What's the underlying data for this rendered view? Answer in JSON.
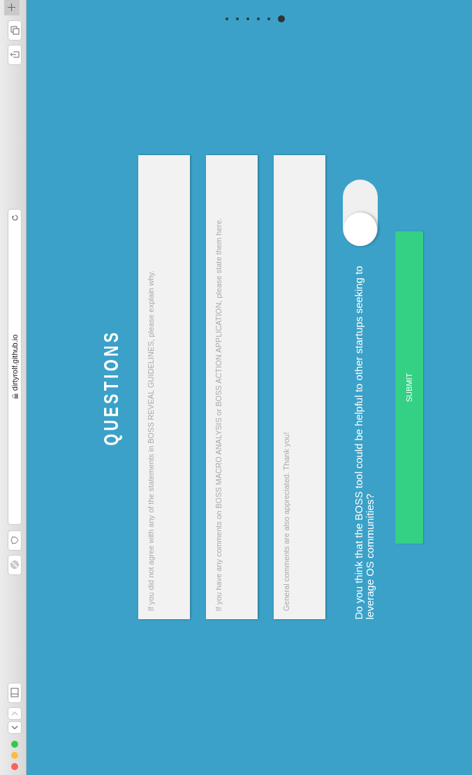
{
  "browser": {
    "address": "dirtyrolf.github.io"
  },
  "page_dots": [
    {
      "selected": false
    },
    {
      "selected": false
    },
    {
      "selected": false
    },
    {
      "selected": false
    },
    {
      "selected": false
    },
    {
      "selected": true
    }
  ],
  "heading": "QUESTIONS",
  "comment_fields": [
    {
      "placeholder": "If you did not agree with any of the statements in BOSS REVEAL GUIDELINES, please explain why."
    },
    {
      "placeholder": "If you have any comments on BOSS MACRO ANALYSIS or BOSS ACTION APPLICATION, please state them here."
    },
    {
      "placeholder": "General comments are also appreciated. Thank you!"
    }
  ],
  "question": {
    "text": "Do you think that the BOSS tool could be helpful to other startups seeking to leverage OS communities?",
    "on": false
  },
  "submit": "SUBMIT"
}
